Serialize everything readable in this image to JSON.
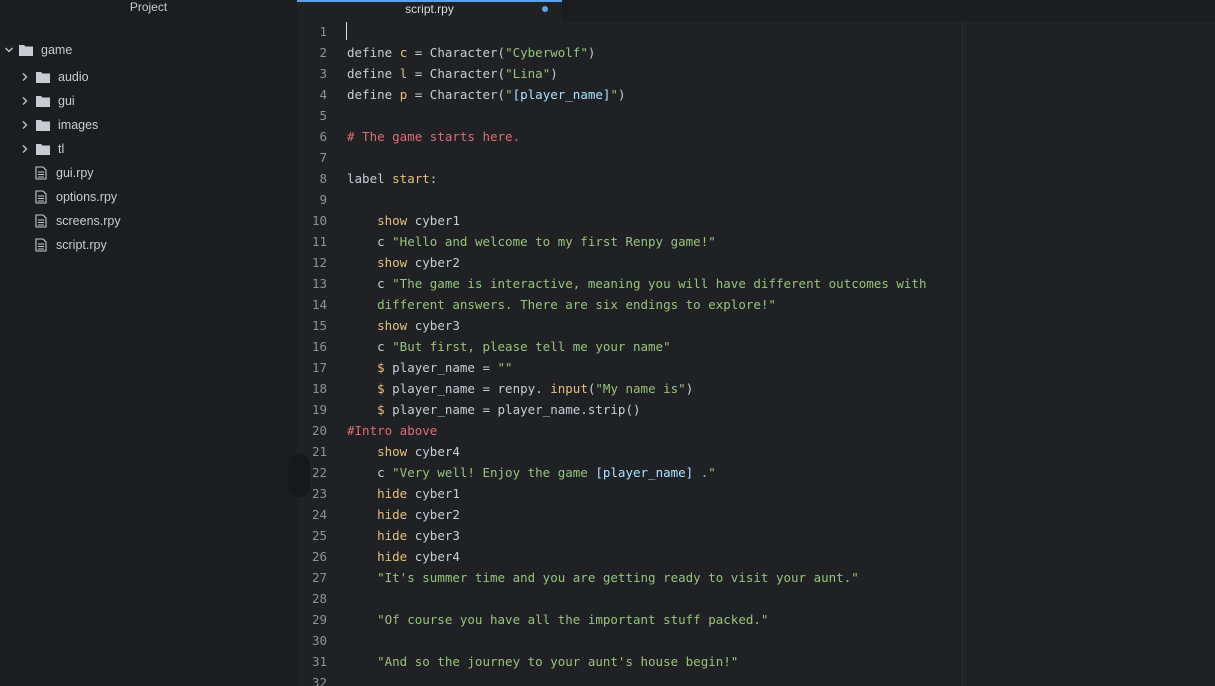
{
  "sidebar": {
    "title": "Project",
    "root": {
      "label": "game"
    },
    "folders": [
      {
        "label": "audio"
      },
      {
        "label": "gui"
      },
      {
        "label": "images"
      },
      {
        "label": "tl"
      }
    ],
    "files": [
      {
        "label": "gui.rpy"
      },
      {
        "label": "options.rpy"
      },
      {
        "label": "screens.rpy"
      },
      {
        "label": "script.rpy"
      }
    ]
  },
  "editor": {
    "tab_title": "script.rpy",
    "tab_modified": true,
    "line_numbers": [
      "1",
      "2",
      "3",
      "4",
      "5",
      "6",
      "7",
      "8",
      "9",
      "10",
      "11",
      "12",
      "13",
      "14",
      "15",
      "16",
      "17",
      "18",
      "19",
      "20",
      "21",
      "22",
      "23",
      "24",
      "25",
      "26",
      "27",
      "28",
      "29",
      "30",
      "31",
      "32"
    ],
    "lines": [
      [],
      [
        {
          "c": "",
          "t": "define "
        },
        {
          "c": "kw",
          "t": "c"
        },
        {
          "c": "",
          "t": " = Character("
        },
        {
          "c": "st",
          "t": "\"Cyberwolf\""
        },
        {
          "c": "",
          "t": ")"
        }
      ],
      [
        {
          "c": "",
          "t": "define "
        },
        {
          "c": "kw",
          "t": "l"
        },
        {
          "c": "",
          "t": " = Character("
        },
        {
          "c": "st",
          "t": "\"Lina\""
        },
        {
          "c": "",
          "t": ")"
        }
      ],
      [
        {
          "c": "",
          "t": "define "
        },
        {
          "c": "kw",
          "t": "p"
        },
        {
          "c": "",
          "t": " = Character("
        },
        {
          "c": "st",
          "t": "\""
        },
        {
          "c": "sub",
          "t": "[player_name]"
        },
        {
          "c": "st",
          "t": "\""
        },
        {
          "c": "",
          "t": ")"
        }
      ],
      [],
      [
        {
          "c": "cm",
          "t": "# The game starts here."
        }
      ],
      [],
      [
        {
          "c": "",
          "t": "label "
        },
        {
          "c": "kw",
          "t": "start"
        },
        {
          "c": "",
          "t": ":"
        }
      ],
      [],
      [
        {
          "c": "",
          "t": "    "
        },
        {
          "c": "kw",
          "t": "show"
        },
        {
          "c": "",
          "t": " cyber1"
        }
      ],
      [
        {
          "c": "",
          "t": "    c "
        },
        {
          "c": "st",
          "t": "\"Hello and welcome to my first Renpy game!\""
        }
      ],
      [
        {
          "c": "",
          "t": "    "
        },
        {
          "c": "kw",
          "t": "show"
        },
        {
          "c": "",
          "t": " cyber2"
        }
      ],
      [
        {
          "c": "",
          "t": "    c "
        },
        {
          "c": "st",
          "t": "\"The game is interactive, meaning you will have different outcomes with"
        }
      ],
      [
        {
          "c": "st",
          "t": "    different answers. There are six endings to explore!\""
        }
      ],
      [
        {
          "c": "",
          "t": "    "
        },
        {
          "c": "kw",
          "t": "show"
        },
        {
          "c": "",
          "t": " cyber3"
        }
      ],
      [
        {
          "c": "",
          "t": "    c "
        },
        {
          "c": "st",
          "t": "\"But first, please tell me your name\""
        }
      ],
      [
        {
          "c": "",
          "t": "    "
        },
        {
          "c": "kw",
          "t": "$"
        },
        {
          "c": "",
          "t": " player_name = "
        },
        {
          "c": "st",
          "t": "\"\""
        }
      ],
      [
        {
          "c": "",
          "t": "    "
        },
        {
          "c": "kw",
          "t": "$"
        },
        {
          "c": "",
          "t": " player_name = renpy. "
        },
        {
          "c": "kw",
          "t": "input"
        },
        {
          "c": "",
          "t": "("
        },
        {
          "c": "st",
          "t": "\"My name is\""
        },
        {
          "c": "",
          "t": ")"
        }
      ],
      [
        {
          "c": "",
          "t": "    "
        },
        {
          "c": "kw",
          "t": "$"
        },
        {
          "c": "",
          "t": " player_name = player_name.strip()"
        }
      ],
      [
        {
          "c": "cm",
          "t": "#Intro above"
        }
      ],
      [
        {
          "c": "",
          "t": "    "
        },
        {
          "c": "kw",
          "t": "show"
        },
        {
          "c": "",
          "t": " cyber4"
        }
      ],
      [
        {
          "c": "",
          "t": "    c "
        },
        {
          "c": "st",
          "t": "\"Very well! Enjoy the game "
        },
        {
          "c": "sub",
          "t": "[player_name]"
        },
        {
          "c": "st",
          "t": " .\""
        }
      ],
      [
        {
          "c": "",
          "t": "    "
        },
        {
          "c": "kw",
          "t": "hide"
        },
        {
          "c": "",
          "t": " cyber1"
        }
      ],
      [
        {
          "c": "",
          "t": "    "
        },
        {
          "c": "kw",
          "t": "hide"
        },
        {
          "c": "",
          "t": " cyber2"
        }
      ],
      [
        {
          "c": "",
          "t": "    "
        },
        {
          "c": "kw",
          "t": "hide"
        },
        {
          "c": "",
          "t": " cyber3"
        }
      ],
      [
        {
          "c": "",
          "t": "    "
        },
        {
          "c": "kw",
          "t": "hide"
        },
        {
          "c": "",
          "t": " cyber4"
        }
      ],
      [
        {
          "c": "st",
          "t": "    \"It's summer time and you are getting ready to visit your aunt.\""
        }
      ],
      [],
      [
        {
          "c": "st",
          "t": "    \"Of course you have all the important stuff packed.\""
        }
      ],
      [],
      [
        {
          "c": "st",
          "t": "    \"And so the journey to your aunt's house begin!\""
        }
      ],
      []
    ]
  },
  "colors": {
    "accent": "#5ba2e8",
    "keyword": "#e5c07b",
    "string": "#98c379",
    "comment": "#e06c75"
  }
}
